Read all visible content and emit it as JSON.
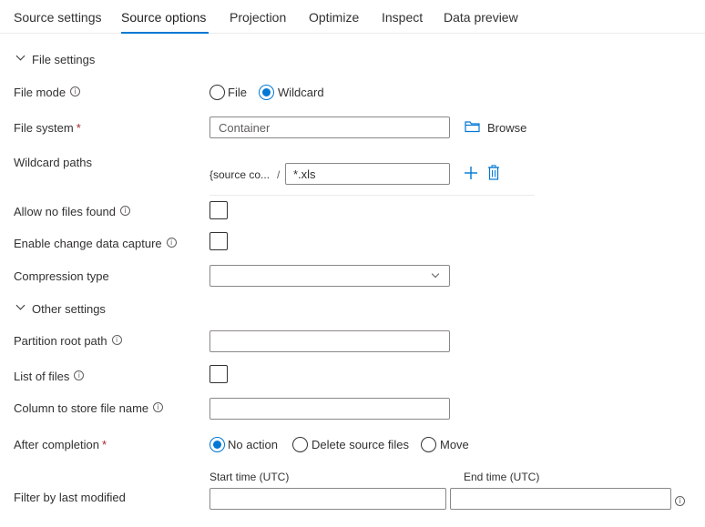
{
  "tabs": [
    {
      "label": "Source settings",
      "active": false
    },
    {
      "label": "Source options",
      "active": true
    },
    {
      "label": "Projection",
      "active": false
    },
    {
      "label": "Optimize",
      "active": false
    },
    {
      "label": "Inspect",
      "active": false
    },
    {
      "label": "Data preview",
      "active": false
    }
  ],
  "file_settings": {
    "title": "File settings",
    "file_mode": {
      "label": "File mode",
      "options": [
        "File",
        "Wildcard"
      ],
      "selected": "Wildcard"
    },
    "file_system": {
      "label": "File system",
      "required_mark": "*",
      "value": "Container",
      "browse_label": "Browse"
    },
    "wildcard_paths": {
      "label": "Wildcard paths",
      "prefix": "{source co...",
      "separator": "/",
      "value": "*.xls"
    },
    "allow_no_files_found": {
      "label": "Allow no files found",
      "checked": false
    },
    "enable_cdc": {
      "label": "Enable change data capture",
      "checked": false
    },
    "compression_type": {
      "label": "Compression type",
      "value": ""
    }
  },
  "other_settings": {
    "title": "Other settings",
    "partition_root_path": {
      "label": "Partition root path",
      "value": ""
    },
    "list_of_files": {
      "label": "List of files",
      "checked": false
    },
    "column_file_name": {
      "label": "Column to store file name",
      "value": ""
    },
    "after_completion": {
      "label": "After completion",
      "required_mark": "*",
      "options": [
        "No action",
        "Delete source files",
        "Move"
      ],
      "selected": "No action"
    },
    "filter_last_modified": {
      "label": "Filter by last modified",
      "start_label": "Start time (UTC)",
      "end_label": "End time (UTC)",
      "start_value": "",
      "end_value": ""
    }
  },
  "colors": {
    "accent": "#0078d4",
    "required": "#a4262c"
  },
  "icons": [
    "info-icon",
    "chevron-down-icon",
    "folder-icon",
    "plus-icon",
    "trash-icon"
  ]
}
